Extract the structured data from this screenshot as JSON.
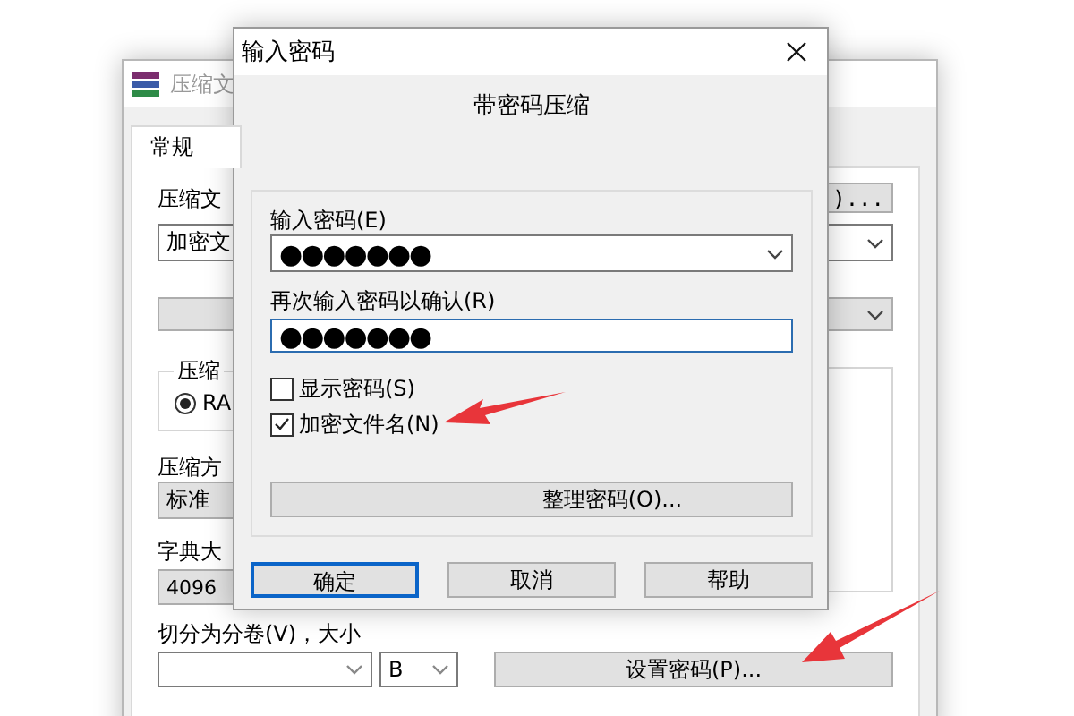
{
  "main_window": {
    "title": "压缩文",
    "tabs": [
      {
        "label": "常规",
        "selected": true
      }
    ],
    "archive_name_label": "压缩文",
    "archive_name_value": "加密文",
    "browse_button": ")...",
    "format_group_label": "压缩",
    "format_options": [
      {
        "label": "RA",
        "selected": true
      }
    ],
    "method_label": "压缩方",
    "method_value": "标准",
    "dictionary_label": "字典大",
    "dictionary_value": "4096",
    "split_label": "切分为分卷(V)，大小",
    "split_unit": "B",
    "set_password_button": "设置密码(P)..."
  },
  "dialog": {
    "title": "输入密码",
    "heading": "带密码压缩",
    "password_label": "输入密码(E)",
    "password_value": "●●●●●●●",
    "confirm_label": "再次输入密码以确认(R)",
    "confirm_value": "●●●●●●●",
    "options": [
      {
        "label": "显示密码(S)",
        "checked": false
      },
      {
        "label": "加密文件名(N)",
        "checked": true
      }
    ],
    "organize_button": "整理密码(O)...",
    "buttons": [
      {
        "label": "确定",
        "default": true
      },
      {
        "label": "取消",
        "default": false
      },
      {
        "label": "帮助",
        "default": false
      }
    ]
  }
}
